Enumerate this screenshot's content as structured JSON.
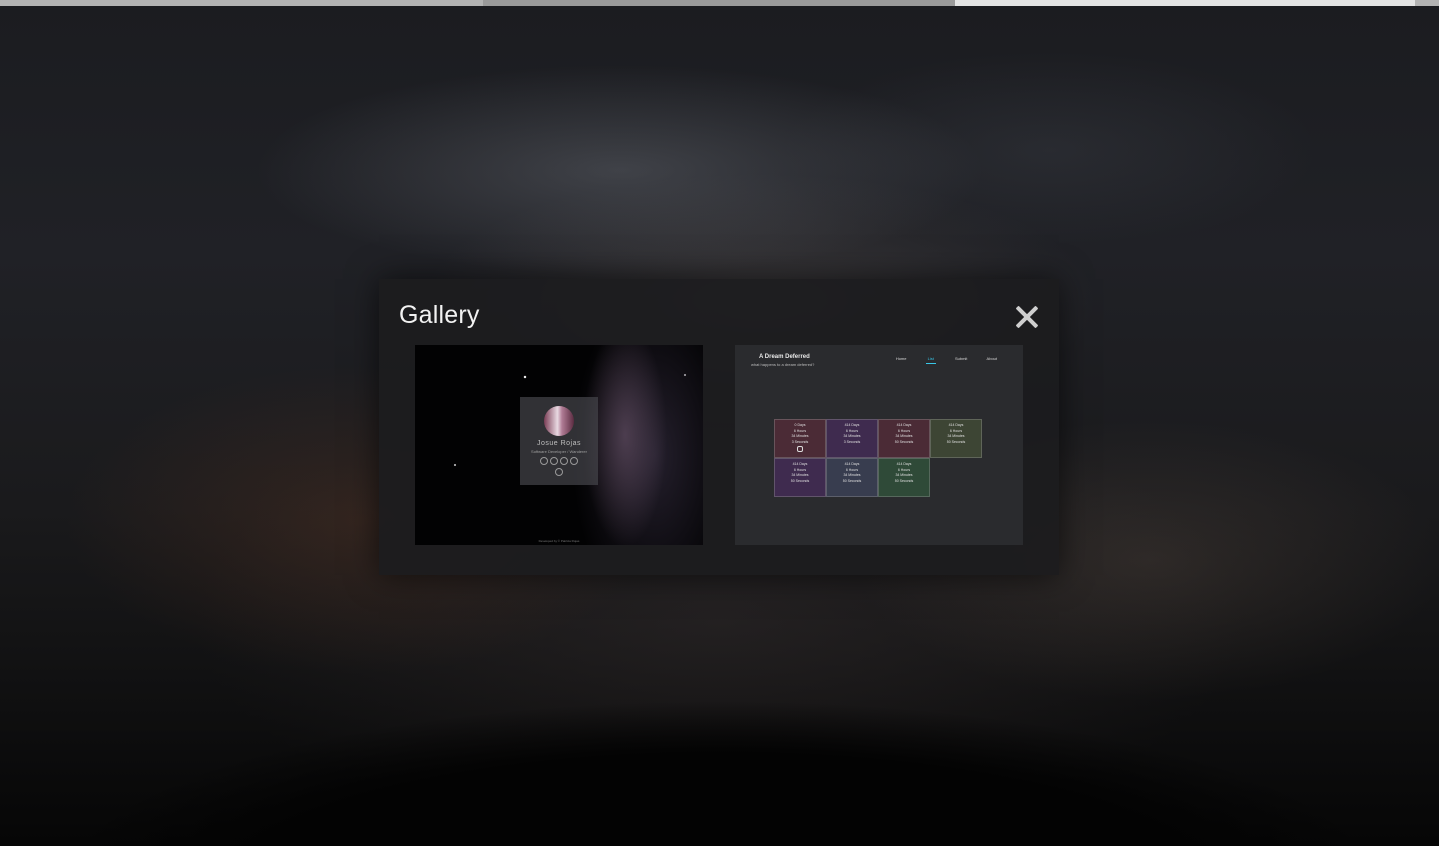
{
  "modal": {
    "title": "Gallery",
    "close_icon": "close-icon"
  },
  "gallery": {
    "item1": {
      "name": "Josue Rojas",
      "role": "Software Developer / Wanderer",
      "footer": "Developed by © Patricia Rojas"
    },
    "item2": {
      "title": "A Dream Deferred",
      "subtitle": "what happens to a dream deferred?",
      "nav": [
        "Home",
        "List",
        "Submit",
        "About"
      ],
      "active_nav": "List",
      "cells": [
        {
          "days": "0 Days",
          "hours": "6 Hours",
          "minutes": "34 Minutes",
          "seconds": "3 Seconds"
        },
        {
          "days": "414 Days",
          "hours": "6 Hours",
          "minutes": "34 Minutes",
          "seconds": "3 Seconds"
        },
        {
          "days": "414 Days",
          "hours": "6 Hours",
          "minutes": "34 Minutes",
          "seconds": "50 Seconds"
        },
        {
          "days": "414 Days",
          "hours": "6 Hours",
          "minutes": "34 Minutes",
          "seconds": "50 Seconds"
        },
        {
          "days": "414 Days",
          "hours": "6 Hours",
          "minutes": "34 Minutes",
          "seconds": "50 Seconds"
        },
        {
          "days": "414 Days",
          "hours": "6 Hours",
          "minutes": "34 Minutes",
          "seconds": "50 Seconds"
        },
        {
          "days": "414 Days",
          "hours": "6 Hours",
          "minutes": "34 Minutes",
          "seconds": "50 Seconds"
        }
      ]
    }
  },
  "colors": {
    "accent": "#38c7e8"
  }
}
